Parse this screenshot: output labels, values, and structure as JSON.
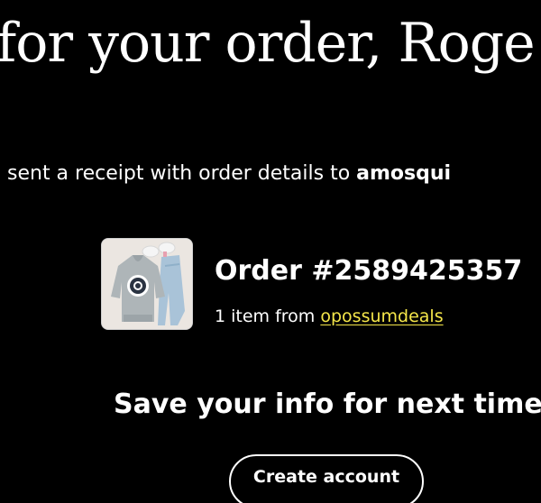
{
  "headline": "for your order, Roge",
  "receipt": {
    "prefix": "sent a receipt with order details to ",
    "email": "amosqui"
  },
  "order": {
    "title": "Order #2589425357",
    "items_text": "1 item from ",
    "seller": "opossumdeals"
  },
  "save_section": {
    "heading": "Save your info for next time",
    "button_label": "Create account"
  },
  "colors": {
    "background": "#000000",
    "text": "#ffffff",
    "link": "#f5e64a"
  },
  "icons": {
    "product_thumbnail": "hoodie-and-jeans-image"
  }
}
